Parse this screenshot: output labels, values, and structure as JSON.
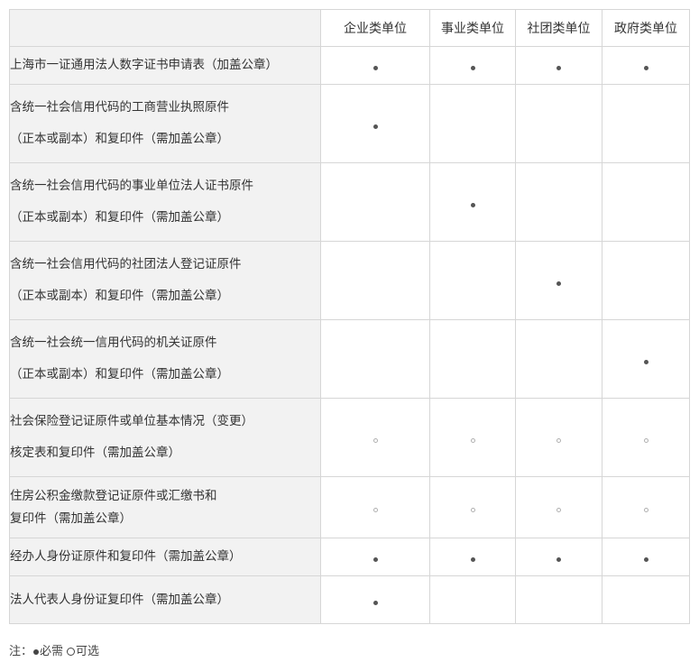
{
  "table": {
    "headers": [
      "",
      "企业类单位",
      "事业类单位",
      "社团类单位",
      "政府类单位"
    ],
    "rows": [
      {
        "lines": [
          "上海市一证通用法人数字证书申请表（加盖公章）"
        ],
        "marks": [
          "required",
          "required",
          "required",
          "required"
        ]
      },
      {
        "lines": [
          "含统一社会信用代码的工商营业执照原件",
          "（正本或副本）和复印件（需加盖公章）"
        ],
        "marks": [
          "required",
          "",
          "",
          ""
        ]
      },
      {
        "lines": [
          "含统一社会信用代码的事业单位法人证书原件",
          "（正本或副本）和复印件（需加盖公章）"
        ],
        "marks": [
          "",
          "required",
          "",
          ""
        ]
      },
      {
        "lines": [
          "含统一社会信用代码的社团法人登记证原件",
          "（正本或副本）和复印件（需加盖公章）"
        ],
        "marks": [
          "",
          "",
          "required",
          ""
        ]
      },
      {
        "lines": [
          "含统一社会统一信用代码的机关证原件",
          "（正本或副本）和复印件（需加盖公章）"
        ],
        "marks": [
          "",
          "",
          "",
          "required"
        ]
      },
      {
        "lines": [
          "社会保险登记证原件或单位基本情况（变更）",
          "核定表和复印件（需加盖公章）"
        ],
        "marks": [
          "optional",
          "optional",
          "optional",
          "optional"
        ]
      },
      {
        "lines": [
          "住房公积金缴款登记证原件或汇缴书和",
          "复印件（需加盖公章）"
        ],
        "marks": [
          "optional",
          "optional",
          "optional",
          "optional"
        ]
      },
      {
        "lines": [
          "经办人身份证原件和复印件（需加盖公章）"
        ],
        "marks": [
          "required",
          "required",
          "required",
          "required"
        ]
      },
      {
        "lines": [
          "法人代表人身份证复印件（需加盖公章）"
        ],
        "marks": [
          "required",
          "",
          "",
          ""
        ]
      }
    ]
  },
  "note": {
    "prefix": "注：",
    "required_label": "必需",
    "optional_label": "可选"
  }
}
